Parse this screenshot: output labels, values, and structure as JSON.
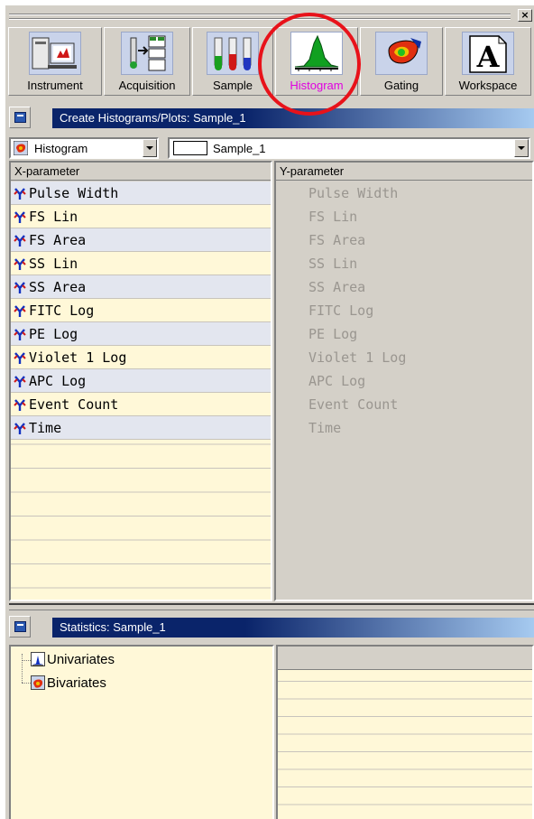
{
  "toolbar": {
    "buttons": [
      {
        "label": "Instrument",
        "icon": "instrument-icon"
      },
      {
        "label": "Acquisition",
        "icon": "acquisition-icon"
      },
      {
        "label": "Sample",
        "icon": "sample-tubes-icon"
      },
      {
        "label": "Histogram",
        "icon": "histogram-icon",
        "active": true
      },
      {
        "label": "Gating",
        "icon": "gating-icon"
      },
      {
        "label": "Workspace",
        "icon": "workspace-icon"
      }
    ],
    "active_label_color": "#e000e0",
    "highlight_circle_color": "#e8121a"
  },
  "histogram_panel": {
    "title": "Create Histograms/Plots: Sample_1",
    "plot_type": "Histogram",
    "sample": "Sample_1",
    "x_header": "X-parameter",
    "y_header": "Y-parameter",
    "x_params": [
      "Pulse Width",
      "FS Lin",
      "FS Area",
      "SS Lin",
      "SS Area",
      "FITC Log",
      "PE Log",
      "Violet 1 Log",
      "APC Log",
      "Event Count",
      "Time"
    ],
    "y_params": [
      "Pulse Width",
      "FS Lin",
      "FS Area",
      "SS Lin",
      "SS Area",
      "FITC Log",
      "PE Log",
      "Violet 1 Log",
      "APC Log",
      "Event Count",
      "Time"
    ]
  },
  "statistics_panel": {
    "title": "Statistics: Sample_1",
    "tree": [
      "Univariates",
      "Bivariates"
    ]
  },
  "colors": {
    "titlebar_dark": "#0a246a",
    "titlebar_light": "#a6caf0",
    "row_highlight": "#e3e6ef",
    "list_background": "#fff8d8",
    "disabled_text": "#9a9690"
  }
}
